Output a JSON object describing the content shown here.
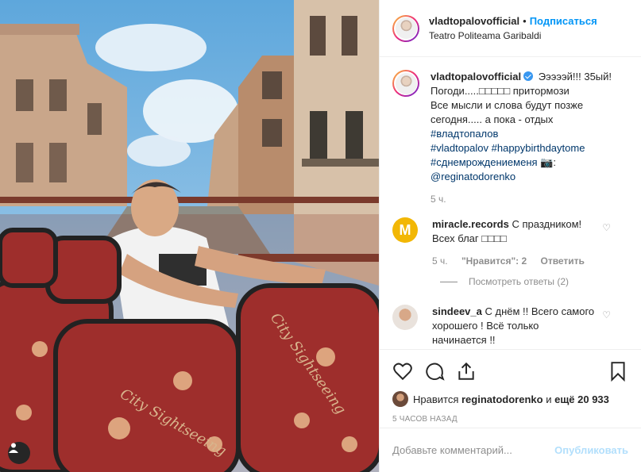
{
  "header": {
    "username": "vladtopalovofficial",
    "follow_label": "Подписаться",
    "location": "Teatro Politeama Garibaldi"
  },
  "caption": {
    "username": "vladtopalovofficial",
    "line1": "Эээээй!!! 35ый!",
    "line2": "Погоди.....□□□□□ притормози",
    "line3": "Все мысли и слова будут позже",
    "line4": "сегодня..... а пока - отдых",
    "tag1": "#владтопалов",
    "tag2": "#vladtopalov",
    "tag3": "#happybirthdaytome",
    "tag4": "#сднемрождениеменя",
    "camera": "📷:",
    "mention": "@reginatodorenko",
    "time": "5 ч."
  },
  "comments": [
    {
      "username": "miracle.records",
      "text_line1": "С праздником!",
      "text_line2": "Всех благ □□□□",
      "avatar_letter": "M",
      "time": "5 ч.",
      "likes": "\"Нравится\": 2",
      "reply_label": "Ответить",
      "view_replies": "Посмотреть ответы (2)"
    },
    {
      "username": "sindeev_a",
      "text_line1": "С днём !! Всего самого",
      "text_line2": "хорошего ! Всё только",
      "text_line3": "начинается !!"
    }
  ],
  "likes": {
    "prefix": "Нравится",
    "user": "reginatodorenko",
    "middle": "и",
    "rest": "ещё 20 933"
  },
  "post_time": "5 ЧАСОВ НАЗАД",
  "add_comment": {
    "placeholder": "Добавьте комментарий...",
    "publish_label": "Опубликовать"
  },
  "colors": {
    "link_blue": "#0095f6",
    "hashtag": "#00376b",
    "muted": "#8e8e8e",
    "seat_red": "#9e2e2c"
  }
}
